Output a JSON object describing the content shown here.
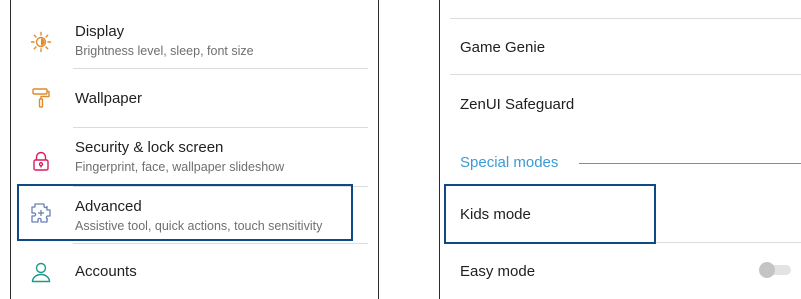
{
  "left": {
    "items": [
      {
        "title": "Display",
        "subtitle": "Brightness level, sleep, font size",
        "icon": "display-brightness-icon"
      },
      {
        "title": "Wallpaper",
        "icon": "paint-roller-icon"
      },
      {
        "title": "Security & lock screen",
        "subtitle": "Fingerprint, face, wallpaper slideshow",
        "icon": "lock-icon"
      },
      {
        "title": "Advanced",
        "subtitle": "Assistive tool, quick actions, touch sensitivity",
        "icon": "puzzle-gear-icon"
      },
      {
        "title": "Accounts",
        "icon": "person-icon"
      }
    ]
  },
  "right": {
    "items": [
      {
        "title": "Game Genie"
      },
      {
        "title": "ZenUI Safeguard"
      }
    ],
    "section_header": "Special modes",
    "special_items": [
      {
        "title": "Kids mode"
      },
      {
        "title": "Easy mode",
        "toggle_on": false
      }
    ]
  },
  "colors": {
    "highlight": "#0d4a86",
    "accent_icon": "#e08a2a",
    "section_header": "#3a9bd5"
  }
}
